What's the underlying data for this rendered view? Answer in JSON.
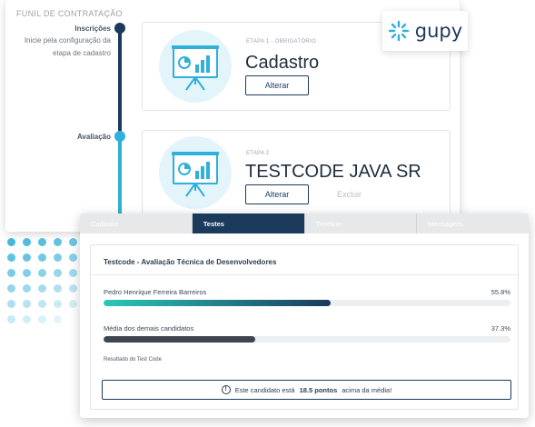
{
  "funnel": {
    "title": "FUNIL DE CONTRATAÇÃO",
    "stages": [
      {
        "name": "Inscrições",
        "description_line1": "Inicie pela configuração da",
        "description_line2": "etapa de cadastro"
      },
      {
        "name": "Avaliação"
      }
    ],
    "steps": [
      {
        "meta": "ETAPA 1 - OBRIGATÓRIO",
        "title": "Cadastro",
        "primary_label": "Alterar"
      },
      {
        "meta": "ETAPA 2",
        "title": "TESTCODE JAVA SR",
        "primary_label": "Alterar",
        "secondary_label": "Excluir"
      }
    ]
  },
  "logo": {
    "text": "gupy",
    "icon": "gupy-spark-icon"
  },
  "tabs": [
    "Cadastro",
    "Testes",
    "Timeline",
    "Mensagens"
  ],
  "active_tab": "Testes",
  "test": {
    "title": "Testcode - Avaliação Técnica de Desenvolvedores",
    "candidate": {
      "name": "Pedro Henrique Ferreira Barreiros",
      "percent_label": "55.8%",
      "percent": 55.8
    },
    "average": {
      "name": "Média dos demais candidatos",
      "percent_label": "37.3%",
      "percent": 37.3
    },
    "result_label": "Resultado do Test Code",
    "notice": {
      "prefix": "Este candidato está",
      "highlight": "18.5 pontos",
      "suffix": "acima da média!"
    }
  },
  "colors": {
    "navy": "#1b3a5c",
    "cyan": "#2fb0d8",
    "teal_gradient_start": "#2bc8b6",
    "teal_gradient_end": "#1b3a5c",
    "average_bar": "#3d4550"
  }
}
